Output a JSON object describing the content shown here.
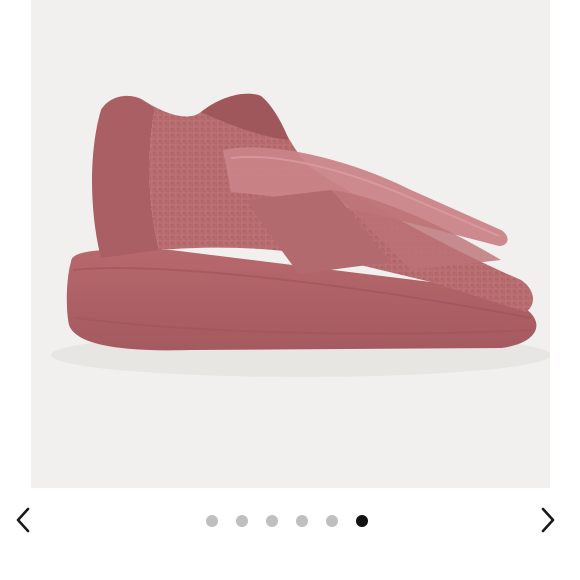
{
  "gallery": {
    "image_alt": "",
    "dot_count": 6,
    "active_index": 5,
    "colors": {
      "photo_background": "#f0efed",
      "shoe": "#b86b6f",
      "dot_inactive": "#bfbfbf",
      "dot_active": "#111111",
      "arrow": "#1a1a1a"
    },
    "icons": {
      "prev": "chevron-left-icon",
      "next": "chevron-right-icon"
    }
  }
}
